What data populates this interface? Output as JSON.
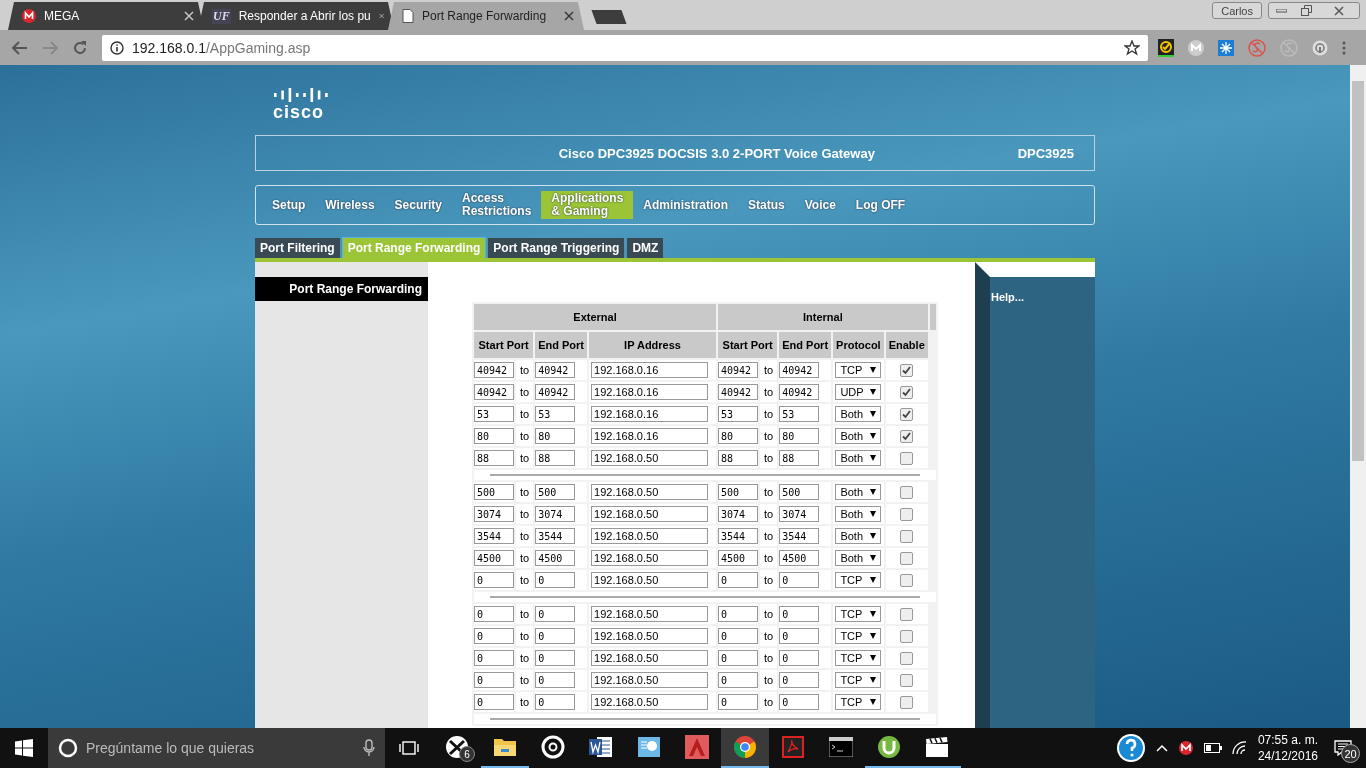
{
  "browser": {
    "tabs": [
      {
        "title": "MEGA",
        "selected": false
      },
      {
        "title": "Responder a Abrir los pu",
        "icon_text": "UF",
        "selected": false
      },
      {
        "title": "Port Range Forwarding",
        "selected": true
      }
    ],
    "profile": "Carlos",
    "address": {
      "host": "192.168.0.1",
      "path": "/AppGaming.asp"
    }
  },
  "router": {
    "logo": "cisco",
    "title": "Cisco DPC3925 DOCSIS 3.0 2-PORT Voice Gateway",
    "model": "DPC3925",
    "nav": [
      {
        "lines": [
          "Setup"
        ],
        "selected": false
      },
      {
        "lines": [
          "Wireless"
        ],
        "selected": false
      },
      {
        "lines": [
          "Security"
        ],
        "selected": false
      },
      {
        "lines": [
          "Access",
          "Restrictions"
        ],
        "selected": false
      },
      {
        "lines": [
          "Applications",
          "& Gaming"
        ],
        "selected": true
      },
      {
        "lines": [
          "Administration"
        ],
        "selected": false
      },
      {
        "lines": [
          "Status"
        ],
        "selected": false
      },
      {
        "lines": [
          "Voice"
        ],
        "selected": false
      },
      {
        "lines": [
          "Log OFF"
        ],
        "selected": false
      }
    ],
    "subtabs": [
      {
        "label": "Port Filtering",
        "selected": false
      },
      {
        "label": "Port Range Forwarding",
        "selected": true
      },
      {
        "label": "Port Range Triggering",
        "selected": false
      },
      {
        "label": "DMZ",
        "selected": false
      }
    ],
    "section": "Port Range Forwarding",
    "help": "Help...",
    "table": {
      "groups": [
        "External",
        "Internal"
      ],
      "columns": [
        "Start Port",
        "End Port",
        "IP Address",
        "Start Port",
        "End Port",
        "Protocol",
        "Enable"
      ],
      "blocks": [
        [
          {
            "ext_start": "40942",
            "to_ext": "to",
            "ext_end": "40942",
            "ip": "192.168.0.16",
            "int_start": "40942",
            "to_int": "to",
            "int_end": "40942",
            "protocol": "TCP",
            "enabled": true
          },
          {
            "ext_start": "40942",
            "to_ext": "to",
            "ext_end": "40942",
            "ip": "192.168.0.16",
            "int_start": "40942",
            "to_int": "to",
            "int_end": "40942",
            "protocol": "UDP",
            "enabled": true
          },
          {
            "ext_start": "53",
            "to_ext": "to",
            "ext_end": "53",
            "ip": "192.168.0.16",
            "int_start": "53",
            "to_int": "to",
            "int_end": "53",
            "protocol": "Both",
            "enabled": true
          },
          {
            "ext_start": "80",
            "to_ext": "to",
            "ext_end": "80",
            "ip": "192.168.0.16",
            "int_start": "80",
            "to_int": "to",
            "int_end": "80",
            "protocol": "Both",
            "enabled": true
          },
          {
            "ext_start": "88",
            "to_ext": "to",
            "ext_end": "88",
            "ip": "192.168.0.50",
            "int_start": "88",
            "to_int": "to",
            "int_end": "88",
            "protocol": "Both",
            "enabled": false
          }
        ],
        [
          {
            "ext_start": "500",
            "to_ext": "to",
            "ext_end": "500",
            "ip": "192.168.0.50",
            "int_start": "500",
            "to_int": "to",
            "int_end": "500",
            "protocol": "Both",
            "enabled": false
          },
          {
            "ext_start": "3074",
            "to_ext": "to",
            "ext_end": "3074",
            "ip": "192.168.0.50",
            "int_start": "3074",
            "to_int": "to",
            "int_end": "3074",
            "protocol": "Both",
            "enabled": false
          },
          {
            "ext_start": "3544",
            "to_ext": "to",
            "ext_end": "3544",
            "ip": "192.168.0.50",
            "int_start": "3544",
            "to_int": "to",
            "int_end": "3544",
            "protocol": "Both",
            "enabled": false
          },
          {
            "ext_start": "4500",
            "to_ext": "to",
            "ext_end": "4500",
            "ip": "192.168.0.50",
            "int_start": "4500",
            "to_int": "to",
            "int_end": "4500",
            "protocol": "Both",
            "enabled": false
          },
          {
            "ext_start": "0",
            "to_ext": "to",
            "ext_end": "0",
            "ip": "192.168.0.50",
            "int_start": "0",
            "to_int": "to",
            "int_end": "0",
            "protocol": "TCP",
            "enabled": false
          }
        ],
        [
          {
            "ext_start": "0",
            "to_ext": "to",
            "ext_end": "0",
            "ip": "192.168.0.50",
            "int_start": "0",
            "to_int": "to",
            "int_end": "0",
            "protocol": "TCP",
            "enabled": false
          },
          {
            "ext_start": "0",
            "to_ext": "to",
            "ext_end": "0",
            "ip": "192.168.0.50",
            "int_start": "0",
            "to_int": "to",
            "int_end": "0",
            "protocol": "TCP",
            "enabled": false
          },
          {
            "ext_start": "0",
            "to_ext": "to",
            "ext_end": "0",
            "ip": "192.168.0.50",
            "int_start": "0",
            "to_int": "to",
            "int_end": "0",
            "protocol": "TCP",
            "enabled": false
          },
          {
            "ext_start": "0",
            "to_ext": "to",
            "ext_end": "0",
            "ip": "192.168.0.50",
            "int_start": "0",
            "to_int": "to",
            "int_end": "0",
            "protocol": "TCP",
            "enabled": false
          },
          {
            "ext_start": "0",
            "to_ext": "to",
            "ext_end": "0",
            "ip": "192.168.0.50",
            "int_start": "0",
            "to_int": "to",
            "int_end": "0",
            "protocol": "TCP",
            "enabled": false
          }
        ]
      ]
    }
  },
  "taskbar": {
    "search_placeholder": "Pregúntame lo que quieras",
    "apps": [
      {
        "kind": "xbox",
        "badge": "6",
        "running": false
      },
      {
        "kind": "folder",
        "running": true
      },
      {
        "kind": "disc",
        "running": false
      },
      {
        "kind": "word",
        "running": false
      },
      {
        "kind": "chart",
        "running": false
      },
      {
        "kind": "cad",
        "running": false
      },
      {
        "kind": "chrome",
        "running": true
      },
      {
        "kind": "pdf",
        "running": false
      },
      {
        "kind": "console",
        "running": false
      },
      {
        "kind": "torrent",
        "running": true
      },
      {
        "kind": "clapper",
        "running": true
      }
    ],
    "time": "07:55 a. m.",
    "date": "24/12/2016",
    "notifications": "20"
  }
}
